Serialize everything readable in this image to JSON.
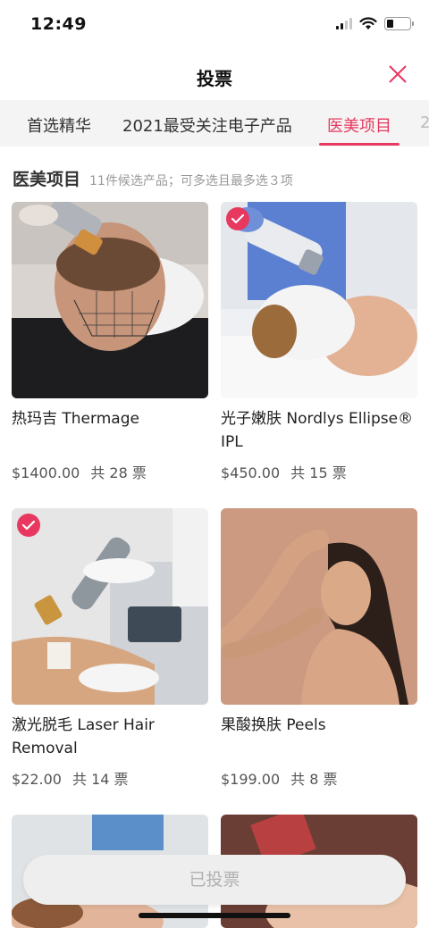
{
  "status": {
    "time": "12:49"
  },
  "header": {
    "title": "投票"
  },
  "tabs": [
    {
      "label": "首选精华"
    },
    {
      "label": "2021最受关注电子产品"
    },
    {
      "label": "医美项目"
    },
    {
      "label": "2"
    }
  ],
  "section": {
    "title": "医美项目",
    "subtitle": "11件候选产品；可多选且最多选３项"
  },
  "products": [
    {
      "name": "热玛吉 Thermage",
      "price": "$1400.00",
      "votes": "共 28 票"
    },
    {
      "name": "光子嫩肤 Nordlys Ellipse® IPL",
      "price": "$450.00",
      "votes": "共 15 票"
    },
    {
      "name": "激光脱毛 Laser Hair Removal",
      "price": "$22.00",
      "votes": "共 14 票"
    },
    {
      "name": "果酸换肤 Peels",
      "price": "$199.00",
      "votes": "共 8 票"
    }
  ],
  "footer": {
    "button": "已投票"
  },
  "colors": {
    "accent": "#e8385f",
    "tab_bg": "#f4f4f4",
    "button_bg": "#eeeeee"
  }
}
